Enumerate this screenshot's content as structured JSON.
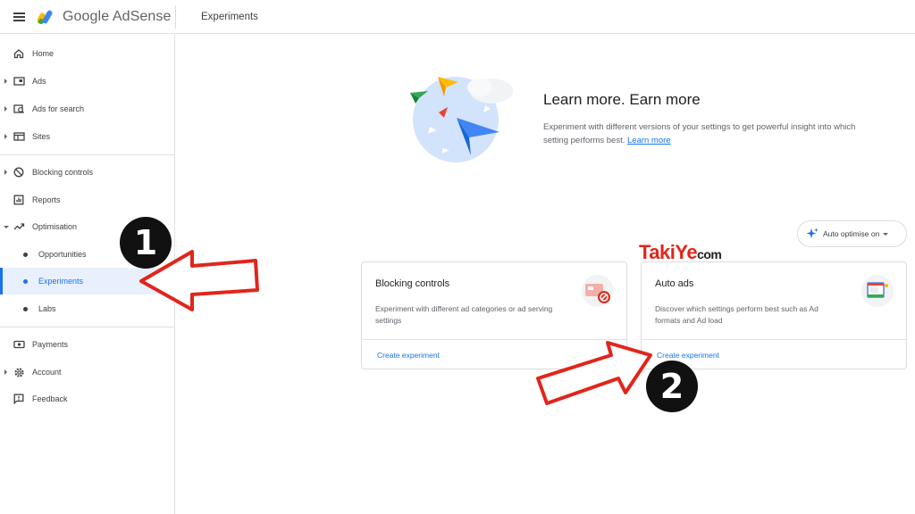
{
  "topbar": {
    "app_name": "Google AdSense",
    "page_title": "Experiments"
  },
  "sidebar": {
    "items": [
      {
        "label": "Home",
        "icon": "home-icon"
      },
      {
        "label": "Ads",
        "icon": "ads-icon"
      },
      {
        "label": "Ads for search",
        "icon": "ads-for-search-icon"
      },
      {
        "label": "Sites",
        "icon": "sites-icon"
      },
      {
        "label": "Blocking controls",
        "icon": "block-icon"
      },
      {
        "label": "Reports",
        "icon": "reports-icon"
      },
      {
        "label": "Optimisation",
        "icon": "trending-up-icon"
      },
      {
        "label": "Opportunities"
      },
      {
        "label": "Experiments",
        "active": true
      },
      {
        "label": "Labs"
      },
      {
        "label": "Payments",
        "icon": "payments-icon"
      },
      {
        "label": "Account",
        "icon": "gear-icon"
      },
      {
        "label": "Feedback",
        "icon": "feedback-icon"
      }
    ]
  },
  "hero": {
    "title": "Learn more. Earn more",
    "description": "Experiment with different versions of your settings to get powerful insight into which setting performs best.",
    "link": "Learn more"
  },
  "auto_optimise": {
    "label": "Auto optimise on"
  },
  "watermark": {
    "brand": "TakiYe",
    "suffix": "com"
  },
  "cards": [
    {
      "title": "Blocking controls",
      "description": "Experiment with different ad categories or ad serving settings",
      "action": "Create experiment",
      "icon": "blocking-illustration-icon"
    },
    {
      "title": "Auto ads",
      "description": "Discover which settings perform best such as Ad formats and Ad load",
      "action": "Create experiment",
      "icon": "auto-ads-illustration-icon"
    }
  ],
  "annotations": {
    "badge1": "1",
    "badge2": "2"
  },
  "colors": {
    "accent": "#1a73e8",
    "active_bg": "#e8f0fe",
    "arrow_red": "#e1251b"
  }
}
